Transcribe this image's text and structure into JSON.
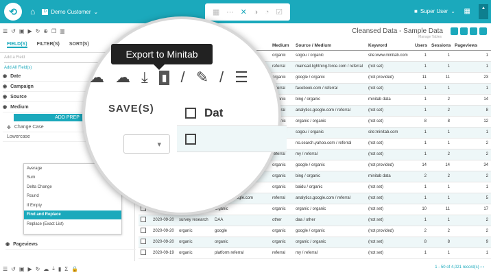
{
  "header": {
    "customer": "Demo Customer",
    "user": "Super User"
  },
  "tabs": [
    "FIELD(S)",
    "FILTER(S)",
    "SORT(S)"
  ],
  "left": {
    "add_field": "Add a Field",
    "add_all": "Add All Field(s)",
    "fields": [
      "Date",
      "Campaign",
      "Source",
      "Medium"
    ],
    "add_prep": "ADD PREP",
    "change_case": "Change Case",
    "lowercase": "Lowercase",
    "options": [
      "Average",
      "Sum",
      "Delta Change",
      "Round",
      "If Empty",
      "Find and Replace",
      "Replace (Exact List)"
    ],
    "pageviews": "Pageviews"
  },
  "dataset": {
    "title": "Cleansed Data - Sample Data",
    "subtitle": "Manage Tables"
  },
  "table": {
    "columns": [
      "",
      "Date",
      "Campaign",
      "Source",
      "Medium",
      "Source / Medium",
      "Keyword",
      "Users",
      "Sessions",
      "Pageviews"
    ],
    "rows": [
      [
        "",
        "",
        "",
        "",
        "organic",
        "sogou / organic",
        "site:www.minitab.com",
        "1",
        "1",
        "1"
      ],
      [
        "",
        "",
        "",
        "...ghtning.force.com",
        "referral",
        "mainsail.lightning.force.com / referral",
        "(not set)",
        "1",
        "1",
        "1"
      ],
      [
        "",
        "",
        "",
        "",
        "organic",
        "google / organic",
        "(not provided)",
        "11",
        "11",
        "23"
      ],
      [
        "",
        "",
        "",
        "...om",
        "referral",
        "facebook.com / referral",
        "(not set)",
        "1",
        "1",
        "1"
      ],
      [
        "",
        "",
        "",
        "",
        "organic",
        "bing / organic",
        "minitab data",
        "1",
        "2",
        "14"
      ],
      [
        "",
        "",
        "",
        "...google.com",
        "referral",
        "analytics.google.com / referral",
        "(not set)",
        "1",
        "2",
        "8"
      ],
      [
        "",
        "",
        "",
        "",
        "organic",
        "organic / organic",
        "(not set)",
        "8",
        "8",
        "12"
      ],
      [
        "",
        "",
        "",
        "",
        "organic",
        "sogou / organic",
        "site:minitab.com",
        "1",
        "1",
        "1"
      ],
      [
        "",
        "",
        "",
        "...no.search.yahoo.com",
        "referral",
        "no.search.yahoo.com / referral",
        "(not set)",
        "1",
        "1",
        "2"
      ],
      [
        "",
        "",
        "",
        "platform referral",
        "referral",
        "my / referral",
        "(not set)",
        "1",
        "2",
        "2"
      ],
      [
        "",
        "2020-09-21",
        "organic",
        "google",
        "organic",
        "google / organic",
        "(not provided)",
        "14",
        "14",
        "34"
      ],
      [
        "",
        "2020-09-21",
        "organic",
        "bing",
        "organic",
        "bing / organic",
        "minitab data",
        "2",
        "2",
        "2"
      ],
      [
        "",
        "2020-09-21",
        "organic",
        "baidu",
        "organic",
        "baidu / organic",
        "(not set)",
        "1",
        "1",
        "1"
      ],
      [
        "",
        "2020-09-21",
        "organic",
        "analytics.google.com",
        "referral",
        "analytics.google.com / referral",
        "(not set)",
        "1",
        "1",
        "5"
      ],
      [
        "",
        "2020-09-21",
        "organic",
        "organic",
        "organic",
        "organic / organic",
        "(not set)",
        "10",
        "11",
        "17"
      ],
      [
        "",
        "2020-09-20",
        "survey research",
        "DAA",
        "other",
        "daa / other",
        "(not set)",
        "1",
        "1",
        "2"
      ],
      [
        "",
        "2020-09-20",
        "organic",
        "google",
        "organic",
        "google / organic",
        "(not provided)",
        "2",
        "2",
        "2"
      ],
      [
        "",
        "2020-09-20",
        "organic",
        "organic",
        "organic",
        "organic / organic",
        "(not set)",
        "8",
        "8",
        "9"
      ],
      [
        "",
        "2020-09-19",
        "organic",
        "platform referral",
        "referral",
        "my / referral",
        "(not set)",
        "1",
        "1",
        "1"
      ]
    ]
  },
  "pager": "1 - 50 of 4,021 record(s)",
  "magnifier": {
    "tooltip": "Export to Minitab",
    "save": "SAVE(S)",
    "col": "Dat"
  }
}
